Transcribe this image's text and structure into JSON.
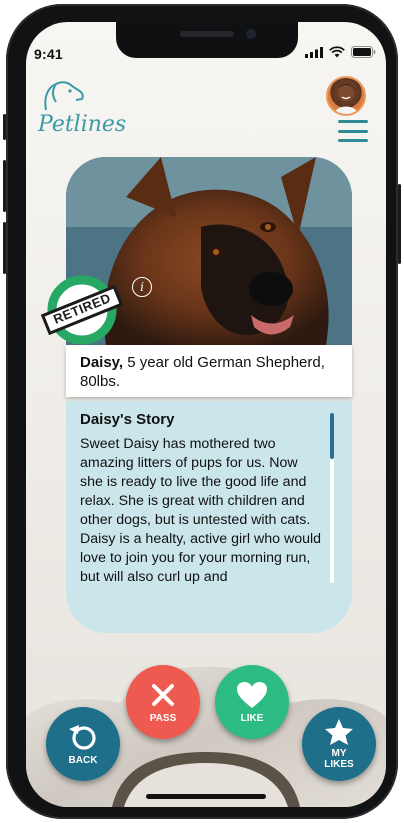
{
  "status": {
    "time": "9:41"
  },
  "app": {
    "logo": "Petlines"
  },
  "profile": {
    "avatar": "user-avatar"
  },
  "dog": {
    "name": "Daisy,",
    "details": "5 year old German Shepherd, 80lbs.",
    "badge": "RETIRED",
    "info_icon": "i"
  },
  "story": {
    "title": "Daisy's Story",
    "body": "Sweet Daisy has mothered two amazing litters of pups for us. Now she is ready to live the good life and relax. She is great with children and other dogs, but is untested with cats. Daisy is a healty, active girl who would love to join you for your morning run, but will also curl up and"
  },
  "actions": {
    "back": "BACK",
    "pass": "PASS",
    "like": "LIKE",
    "my_likes_1": "MY",
    "my_likes_2": "LIKES"
  },
  "colors": {
    "accent": "#3a9aa5",
    "back": "#1f6f8b",
    "pass": "#ee5a4f",
    "like": "#2dbb84",
    "story_bg": "#cbe6eb",
    "badge": "#27a865"
  }
}
